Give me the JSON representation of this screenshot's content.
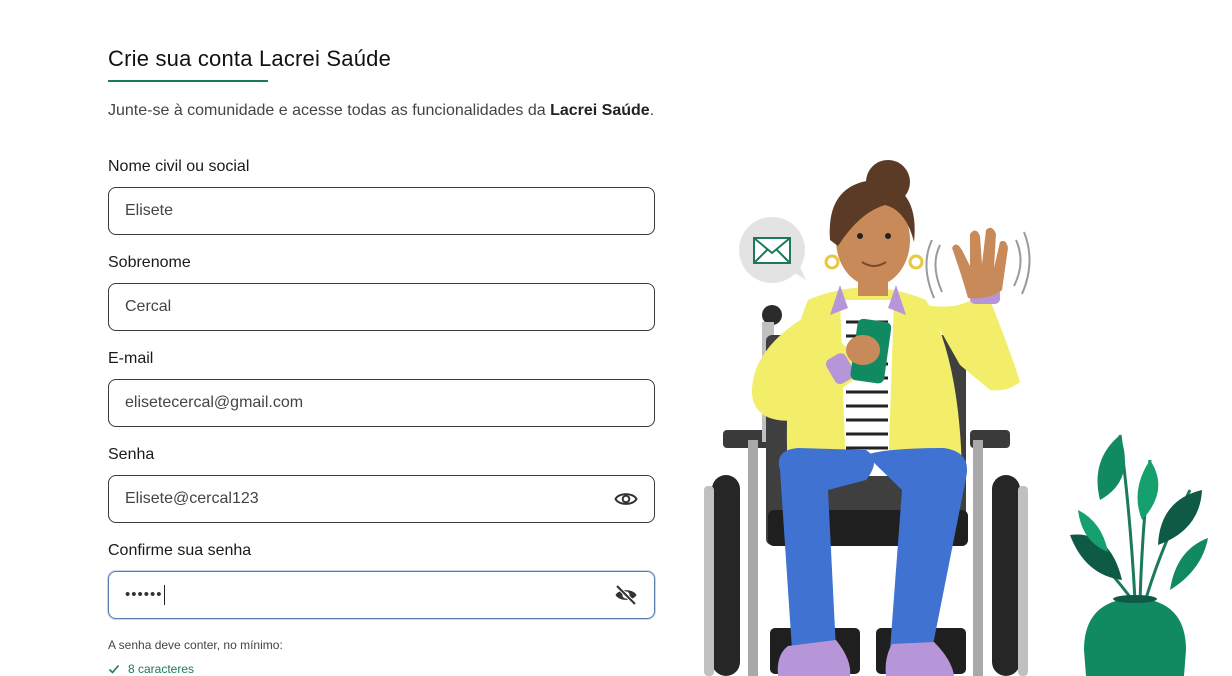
{
  "header": {
    "title": "Crie sua conta Lacrei Saúde",
    "subtitle_prefix": "Junte-se à comunidade e acesse todas as funcionalidades da ",
    "subtitle_brand": "Lacrei Saúde",
    "subtitle_suffix": "."
  },
  "form": {
    "first_name": {
      "label": "Nome civil ou social",
      "value": "Elisete"
    },
    "last_name": {
      "label": "Sobrenome",
      "value": "Cercal"
    },
    "email": {
      "label": "E-mail",
      "value": "elisetecercal@gmail.com"
    },
    "password": {
      "label": "Senha",
      "value": "Elisete@cercal123"
    },
    "confirm_password": {
      "label": "Confirme sua senha",
      "value": "••••••"
    },
    "password_hint": "A senha deve conter, no mínimo:",
    "requirements": [
      {
        "label": "8 caracteres",
        "met": true
      }
    ]
  },
  "colors": {
    "accent": "#1c7a5a",
    "jacket": "#f2ee6a",
    "pants": "#3f72d1",
    "skin": "#c98a5a",
    "plant": "#118a62"
  },
  "icons": {
    "show_password": "eye-icon",
    "hide_password": "eye-off-icon",
    "requirement_met": "check-icon",
    "message": "envelope-icon"
  }
}
